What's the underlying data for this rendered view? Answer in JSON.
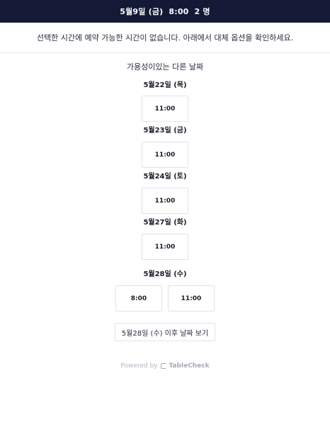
{
  "header": {
    "date": "5월9일 (금)",
    "time": "8:00",
    "party": "2 명"
  },
  "notice": "선택한 시간에 예약 가능한 시간이 없습니다. 아래에서 대체 옵션을 확인하세요.",
  "alternatives_title": "가용성이있는 다른 날짜",
  "dates": [
    {
      "label": "5월22일 (목)",
      "slots": [
        "11:00"
      ]
    },
    {
      "label": "5월23일 (금)",
      "slots": [
        "11:00"
      ]
    },
    {
      "label": "5월24일 (토)",
      "slots": [
        "11:00"
      ]
    },
    {
      "label": "5월27일 (화)",
      "slots": [
        "11:00"
      ]
    },
    {
      "label": "5월28일 (수)",
      "slots": [
        "8:00",
        "11:00"
      ]
    }
  ],
  "later_button": "5월28일 (수) 이후 날짜 보기",
  "footer": {
    "powered_by": "Powered by",
    "brand": "TableCheck",
    "logo_icon": "tablecheck-logo-icon"
  }
}
